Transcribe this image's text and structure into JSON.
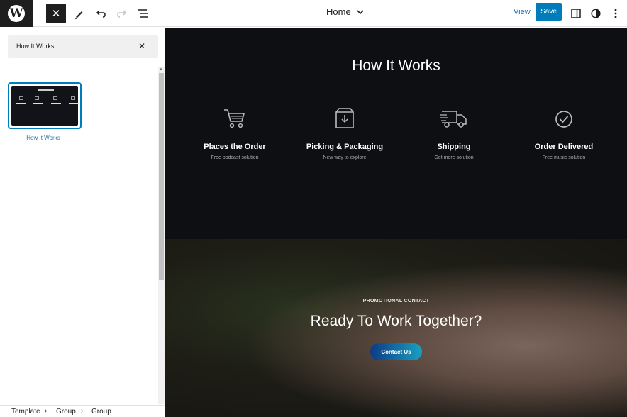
{
  "topbar": {
    "logo_letter": "W",
    "close_icon": "✕",
    "doc_title": "Home",
    "view_label": "View",
    "save_label": "Save"
  },
  "sidebar": {
    "search_value": "How It Works",
    "clear_icon": "✕",
    "pattern_label": "How It Works"
  },
  "canvas": {
    "how_title": "How It Works",
    "features": [
      {
        "icon": "cart-icon",
        "title": "Places the Order",
        "subtitle": "Free podcast solution"
      },
      {
        "icon": "box-icon",
        "title": "Picking & Packaging",
        "subtitle": "New way to explore"
      },
      {
        "icon": "truck-icon",
        "title": "Shipping",
        "subtitle": "Get more solution"
      },
      {
        "icon": "check-circle-icon",
        "title": "Order Delivered",
        "subtitle": "Free music solution"
      }
    ],
    "promo_kicker": "PROMOTIONAL CONTACT",
    "promo_title": "Ready To Work Together?",
    "contact_label": "Contact Us"
  },
  "breadcrumb": [
    "Template",
    "Group",
    "Group"
  ],
  "colors": {
    "accent": "#007cba",
    "canvas_dark": "#0e0f13",
    "button_gradient_start": "#0d3a86",
    "button_gradient_end": "#1aa0c0"
  }
}
